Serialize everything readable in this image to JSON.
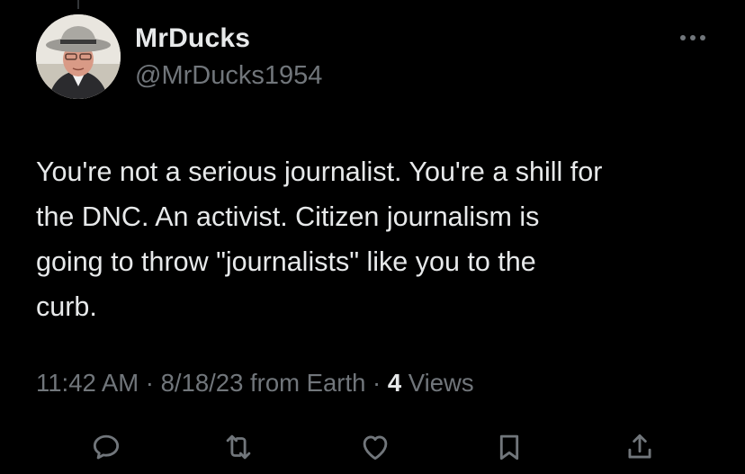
{
  "tweet": {
    "display_name": "MrDucks",
    "handle": "@MrDucks1954",
    "text": "You're not a serious journalist. You're a shill for\nthe DNC. An activist. Citizen journalism is\ngoing to throw \"journalists\" like you to the\ncurb.",
    "time": "11:42 AM",
    "date": "8/18/23",
    "source": "from Earth",
    "separator": "·",
    "views_count": "4",
    "views_label": "Views"
  },
  "colors": {
    "background": "#000000",
    "primary_text": "#e7e9ea",
    "secondary_text": "#71767b"
  },
  "icons": {
    "more": "more-horizontal-icon",
    "reply": "reply-icon",
    "retweet": "retweet-icon",
    "like": "heart-icon",
    "bookmark": "bookmark-icon",
    "share": "share-icon"
  }
}
